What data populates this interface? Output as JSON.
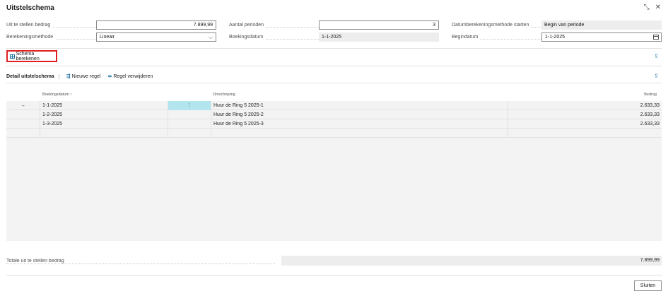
{
  "window": {
    "title": "Uitstelschema",
    "collapse_icon": "⤡",
    "close_icon": "✕"
  },
  "header": {
    "fields": [
      {
        "label": "Uit te stellen bedrag",
        "value": "7.899,99"
      },
      {
        "label": "Aantal perioden",
        "value": "3"
      },
      {
        "label": "Datumberekeningsmethode starten",
        "value": "Begin van periode"
      },
      {
        "label": "Berekeningsmethode",
        "value": "Lineair"
      },
      {
        "label": "Boekingsdatum",
        "value": "1-1-2025"
      },
      {
        "label": "Begindatum",
        "value": "1-1-2025"
      }
    ]
  },
  "actions": {
    "calculate_label": "Schema berekenen",
    "share_icon": "⇪"
  },
  "lines": {
    "title": "Detail uitstelschema",
    "new_line_label": "Nieuwe regel",
    "delete_line_label": "Regel verwijderen",
    "columns": {
      "posting_date": "Boekingsdatum ↑",
      "description": "Omschrijving",
      "amount": "Bedrag"
    },
    "rows": [
      {
        "marker": "→",
        "posting_date": "1-1-2025",
        "menu": "⋮",
        "description": "Huur de Ring 5 2025-1",
        "amount": "2.633,33"
      },
      {
        "marker": "",
        "posting_date": "1-2-2025",
        "menu": "",
        "description": "Huur de Ring 5 2025-2",
        "amount": "2.633,33"
      },
      {
        "marker": "",
        "posting_date": "1-3-2025",
        "menu": "",
        "description": "Huur de Ring 5 2025-3",
        "amount": "2.633,33"
      }
    ]
  },
  "totals": {
    "label": "Totale uit te stellen bedrag",
    "value": "7.899,99"
  },
  "footer": {
    "close_label": "Sluiten"
  },
  "colors": {
    "accent": "#1a6fa0",
    "highlight": "#e02020",
    "selected_cell": "#b3e5ee"
  }
}
